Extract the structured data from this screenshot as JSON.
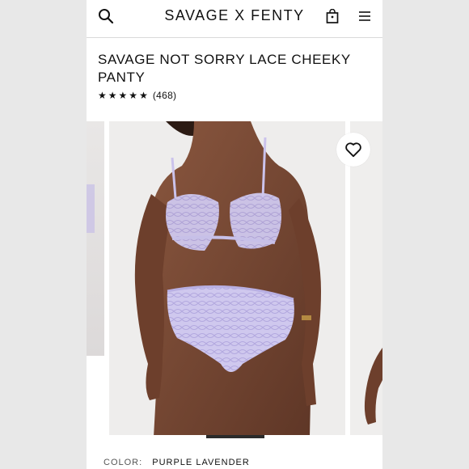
{
  "header": {
    "brand": "SAVAGE X FENTY",
    "icons": [
      "search-icon",
      "shopping-bag-icon",
      "hamburger-menu-icon"
    ]
  },
  "product": {
    "title": "SAVAGE NOT SORRY LACE CHEEKY PANTY",
    "rating": {
      "stars": 5,
      "count_text": "(468)"
    }
  },
  "gallery": {
    "favorite_icon": "heart-icon",
    "active_index": 1
  },
  "color": {
    "label": "COLOR:",
    "value": "PURPLE LAVENDER"
  },
  "colors": {
    "text": "#111111",
    "lace": "#c7c0e8",
    "skin": "#7a4a34"
  }
}
